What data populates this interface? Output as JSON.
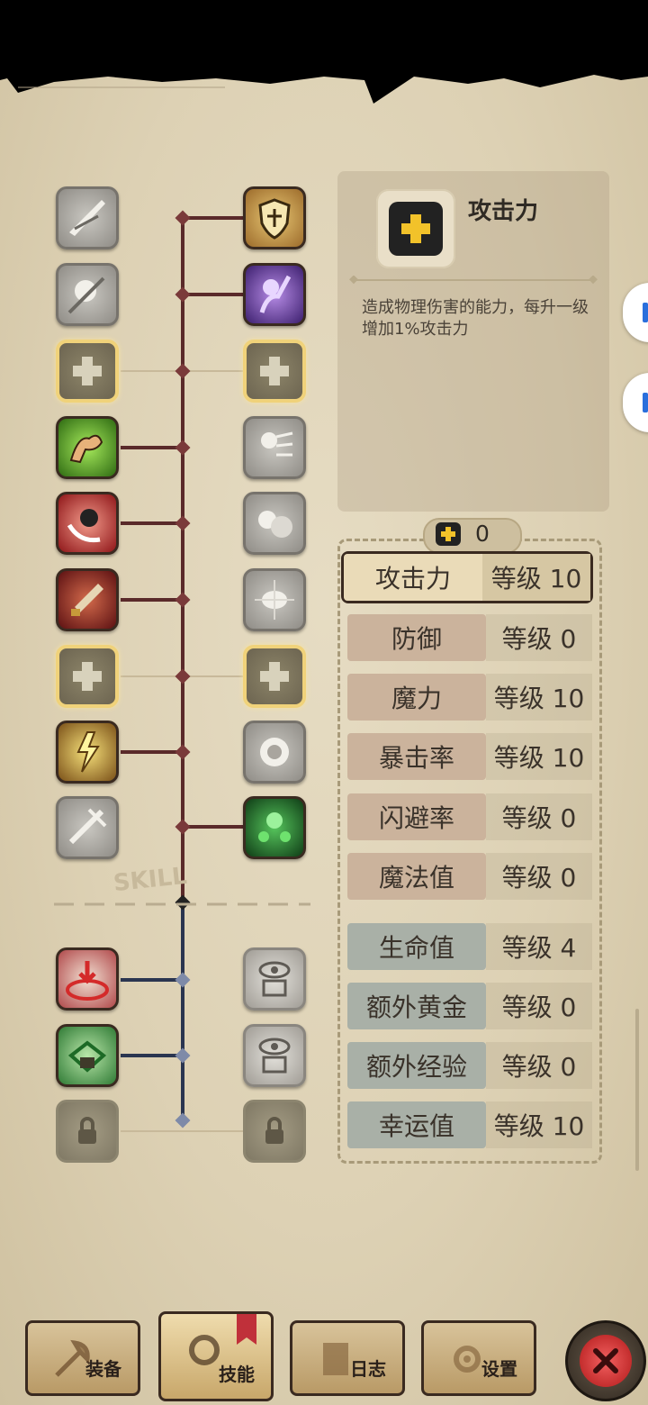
{
  "info": {
    "title": "攻击力",
    "description": "造成物理伤害的能力，每升一级增加1%攻击力"
  },
  "points": {
    "value": "0"
  },
  "skill_watermark": "SKILL",
  "stats": [
    {
      "name": "攻击力",
      "level": "等级 10",
      "selected": true
    },
    {
      "name": "防御",
      "level": "等级 0"
    },
    {
      "name": "魔力",
      "level": "等级 10"
    },
    {
      "name": "暴击率",
      "level": "等级 10"
    },
    {
      "name": "闪避率",
      "level": "等级 0"
    },
    {
      "name": "魔法值",
      "level": "等级 0"
    },
    {
      "name": "生命值",
      "level": "等级 4"
    },
    {
      "name": "额外黄金",
      "level": "等级 0"
    },
    {
      "name": "额外经验",
      "level": "等级 0"
    },
    {
      "name": "幸运值",
      "level": "等级 10"
    }
  ],
  "nav": {
    "equipment": "装备",
    "skills": "技能",
    "log": "日志",
    "settings": "设置"
  },
  "colors": {
    "tree_line_upper": "#5a2a2a",
    "tree_line_lower": "#2a3550",
    "stat_name_red_bg": "#cbb39c",
    "stat_name_blue_bg": "#a9b0a7",
    "selected_border": "#3a2a20",
    "close_red": "#d42a2a"
  }
}
